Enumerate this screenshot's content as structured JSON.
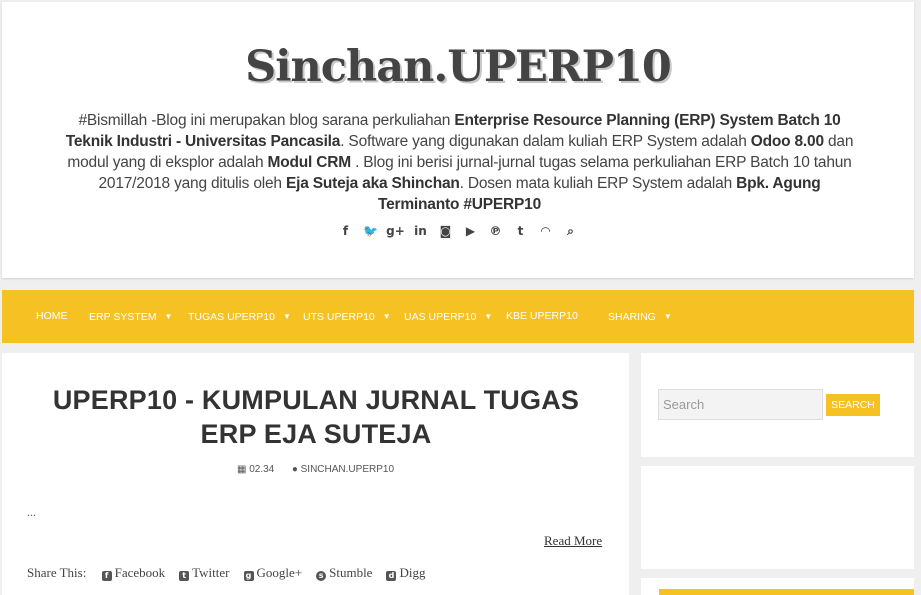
{
  "header": {
    "site_title": "Sinchan.UPERP10",
    "description": [
      {
        "text": "#Bismillah -Blog ini merupakan blog sarana perkuliahan ",
        "bold": false
      },
      {
        "text": "Enterprise Resource Planning (ERP) System Batch 10 Teknik Industri - Universitas Pancasila",
        "bold": true
      },
      {
        "text": ". Software yang digunakan dalam kuliah ERP System adalah ",
        "bold": false
      },
      {
        "text": "Odoo 8.00",
        "bold": true
      },
      {
        "text": " dan modul yang di eksplor adalah ",
        "bold": false
      },
      {
        "text": "Modul CRM",
        "bold": true
      },
      {
        "text": " . Blog ini berisi jurnal-jurnal tugas selama perkuliahan ERP Batch 10 tahun 2017/2018 yang ditulis oleh ",
        "bold": false
      },
      {
        "text": "Eja Suteja aka Shinchan",
        "bold": true
      },
      {
        "text": ". Dosen mata kuliah ERP System adalah ",
        "bold": false
      },
      {
        "text": "Bpk. Agung Terminanto #UPERP10",
        "bold": true
      }
    ],
    "social_icons": [
      {
        "name": "facebook-icon",
        "glyph": "f"
      },
      {
        "name": "twitter-icon",
        "glyph": "🐦"
      },
      {
        "name": "google-plus-icon",
        "glyph": "g+"
      },
      {
        "name": "linkedin-icon",
        "glyph": "in"
      },
      {
        "name": "instagram-icon",
        "glyph": "◙"
      },
      {
        "name": "youtube-icon",
        "glyph": "▶"
      },
      {
        "name": "pinterest-icon",
        "glyph": "℗"
      },
      {
        "name": "tumblr-icon",
        "glyph": "t"
      },
      {
        "name": "rss-icon",
        "glyph": "◠"
      },
      {
        "name": "search-icon",
        "glyph": "⌕"
      }
    ]
  },
  "nav": {
    "items": [
      {
        "label": "HOME",
        "dropdown": false
      },
      {
        "label": "ERP SYSTEM",
        "dropdown": true
      },
      {
        "label": "TUGAS UPERP10",
        "dropdown": true
      },
      {
        "label": "UTS UPERP10",
        "dropdown": true
      },
      {
        "label": "UAS UPERP10",
        "dropdown": true
      },
      {
        "label": "KBE UPERP10",
        "dropdown": false
      },
      {
        "label": "SHARING",
        "dropdown": true
      }
    ]
  },
  "post": {
    "title": "UPERP10 - KUMPULAN JURNAL TUGAS ERP EJA SUTEJA",
    "time": "02.34",
    "author": "SINCHAN.UPERP10",
    "excerpt": "...",
    "read_more": "Read More",
    "share_label": "Share This:",
    "share_items": [
      {
        "label": "Facebook",
        "icon": "facebook-icon",
        "glyph": "f",
        "round": false
      },
      {
        "label": "Twitter",
        "icon": "twitter-icon",
        "glyph": "t",
        "round": false
      },
      {
        "label": "Google+",
        "icon": "google-plus-icon",
        "glyph": "g",
        "round": false
      },
      {
        "label": "Stumble",
        "icon": "stumbleupon-icon",
        "glyph": "s",
        "round": true
      },
      {
        "label": "Digg",
        "icon": "digg-icon",
        "glyph": "d",
        "round": false
      }
    ]
  },
  "sidebar": {
    "search_placeholder": "Search",
    "search_button": "SEARCH"
  },
  "colors": {
    "accent": "#f5c123",
    "background": "#efefef"
  }
}
